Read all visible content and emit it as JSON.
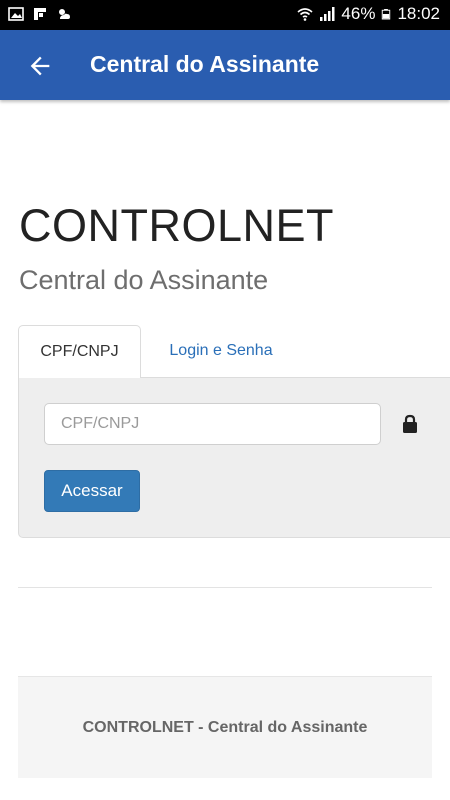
{
  "status_bar": {
    "battery": "46%",
    "time": "18:02",
    "left_icons": [
      "image-icon",
      "flipboard-icon",
      "weather-icon"
    ],
    "right_icons": [
      "wifi-icon",
      "signal-icon",
      "battery-icon"
    ]
  },
  "app_bar": {
    "title": "Central do Assinante",
    "back_icon": "arrow-back-icon",
    "color": "#2a5db0"
  },
  "header": {
    "brand": "CONTROLNET",
    "subtitle": "Central do Assinante"
  },
  "tabs": [
    {
      "label": "CPF/CNPJ",
      "active": true
    },
    {
      "label": "Login e Senha",
      "active": false
    }
  ],
  "form": {
    "cpf_placeholder": "CPF/CNPJ",
    "cpf_value": "",
    "submit_label": "Acessar",
    "button_color": "#337ab7"
  },
  "footer": {
    "text": "CONTROLNET - Central do Assinante"
  }
}
